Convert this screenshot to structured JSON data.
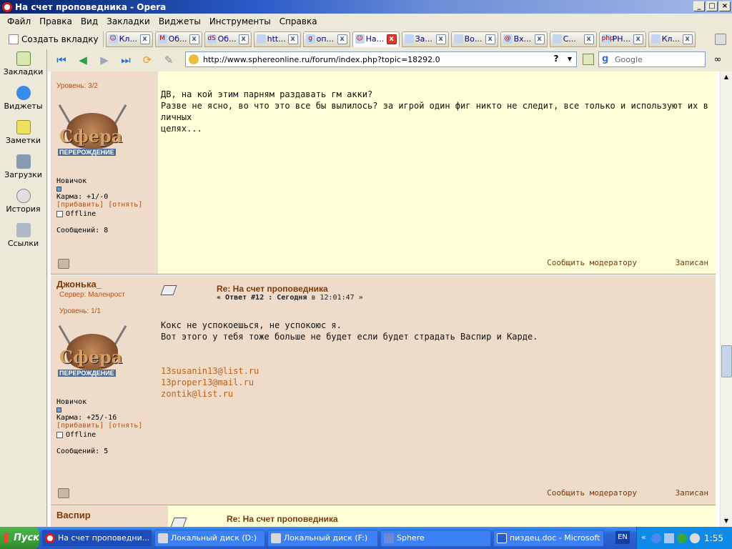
{
  "window": {
    "title": "На счет проповедника - Opera"
  },
  "menu": [
    "Файл",
    "Правка",
    "Вид",
    "Закладки",
    "Виджеты",
    "Инструменты",
    "Справка"
  ],
  "tabbar": {
    "new_tab": "Создать вкладку",
    "tabs": [
      {
        "label": "Кл...",
        "fav": "☺"
      },
      {
        "label": "Об...",
        "fav": "M"
      },
      {
        "label": "Об...",
        "fav": "dS"
      },
      {
        "label": "htt...",
        "fav": ""
      },
      {
        "label": "оп...",
        "fav": "g"
      },
      {
        "label": "На...",
        "fav": "☺"
      },
      {
        "label": "За...",
        "fav": ""
      },
      {
        "label": "Во...",
        "fav": ""
      },
      {
        "label": "Вх...",
        "fav": "@"
      },
      {
        "label": "С...",
        "fav": ""
      },
      {
        "label": "РН...",
        "fav": "php"
      },
      {
        "label": "Кл...",
        "fav": ""
      }
    ]
  },
  "sidebar": [
    "Закладки",
    "Виджеты",
    "Заметки",
    "Загрузки",
    "История",
    "Ссылки"
  ],
  "address": {
    "url": "http://www.sphereonline.ru/forum/index.php?topic=18292.0",
    "help": "?"
  },
  "search": {
    "placeholder": "Google"
  },
  "posts": [
    {
      "level": "Уровень: 3/2",
      "avatar_word": "Сфера",
      "avatar_sub": "ПЕРЕРОЖДЕНИЕ",
      "rank": "Новичок",
      "karma": "Карма: +1/-0",
      "karma_links": "[прибавить] [отнять]",
      "status": "Offline",
      "messages": "Сообщений: 8",
      "text": "ДВ, на кой этим парням раздавать гм акки?\nРазве не ясно, во что это все бы вылилось? за игрой один фиг никто не следит, все только и используют их в личных\nцелях...",
      "report": "Сообщить модератору",
      "record": "Записан"
    },
    {
      "username": "Джонька_",
      "server": "Сервер: Маленрост",
      "level": "Уровень: 1/1",
      "avatar_word": "Сфера",
      "avatar_sub": "ПЕРЕРОЖДЕНИЕ",
      "rank": "Новичок",
      "karma": "Карма: +25/-16",
      "karma_links": "[прибавить] [отнять]",
      "status": "Offline",
      "messages": "Сообщений: 5",
      "title": "Re: На счет проповедника",
      "meta_prefix": "« Ответ #12 : Сегодня",
      "meta_time": " в 12:01:47 »",
      "text": "Кокс не успокоешься, не успокоюс я.\nВот этого у тебя тоже больше не будет если будет страдать Васпир и Карде.",
      "emails": [
        "13susanin13@list.ru",
        "13proper13@mail.ru",
        "zontik@list.ru"
      ],
      "report": "Сообщить модератору",
      "record": "Записан"
    },
    {
      "username": "Васпир",
      "title": "Re: На счет проповедника"
    }
  ],
  "taskbar": {
    "start": "Пуск",
    "tasks": [
      "На счет проповедни...",
      "Локальный диск (D:)",
      "Локальный диск (F:)",
      "Sphere",
      "пиздец.doc - Microsoft ..."
    ],
    "lang": "EN",
    "clock": "1:55"
  },
  "colors": {
    "post_bg": "#ffffd8",
    "info_bg": "#efdbc9",
    "accent": "#7a3a0a",
    "link": "#b85010"
  }
}
